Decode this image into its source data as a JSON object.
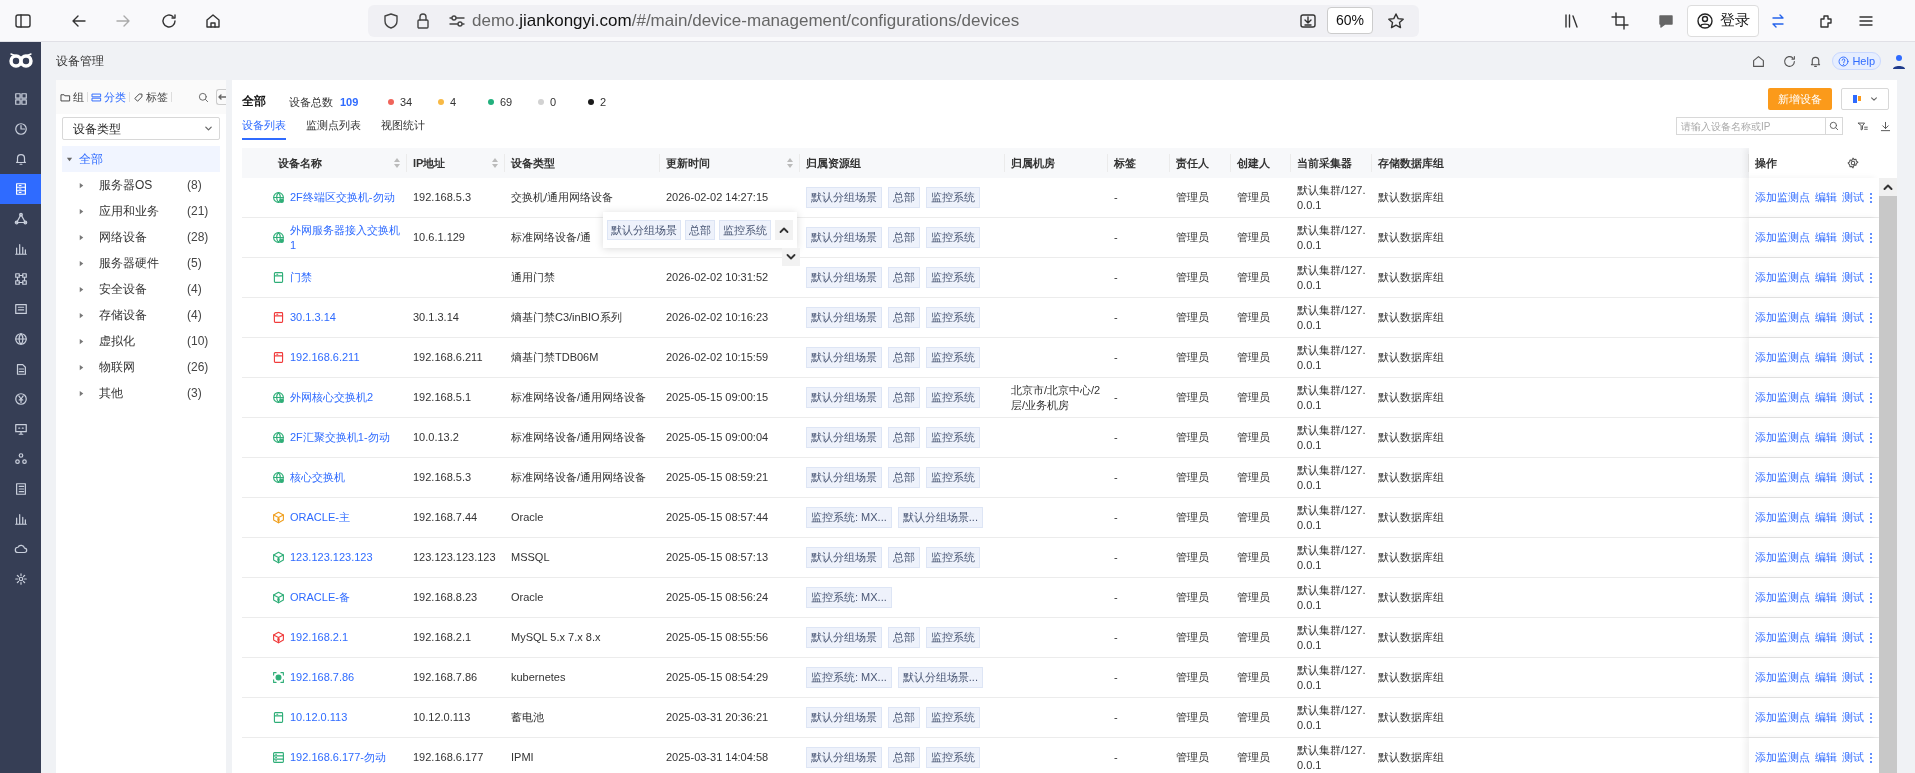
{
  "browser": {
    "url": {
      "prefix": "demo.",
      "domain": "jiankongyi.com",
      "path": "/#/main/device-management/configurations/devices"
    },
    "zoom": "60%",
    "account_label": "登录"
  },
  "app": {
    "page_title": "设备管理",
    "help_label": "Help"
  },
  "nav": [
    {
      "kind": "grid",
      "selected": false
    },
    {
      "kind": "clock",
      "selected": false
    },
    {
      "kind": "bell",
      "selected": false
    },
    {
      "kind": "server",
      "selected": true
    },
    {
      "kind": "triangle",
      "selected": false
    },
    {
      "kind": "bars",
      "selected": false
    },
    {
      "kind": "nodes",
      "selected": false
    },
    {
      "kind": "panel",
      "selected": false
    },
    {
      "kind": "globe",
      "selected": false
    },
    {
      "kind": "document",
      "selected": false
    },
    {
      "kind": "yen",
      "selected": false
    },
    {
      "kind": "monitor",
      "selected": false
    },
    {
      "kind": "cluster",
      "selected": false
    },
    {
      "kind": "list",
      "selected": false
    },
    {
      "kind": "bars",
      "selected": false
    },
    {
      "kind": "cloud",
      "selected": false
    },
    {
      "kind": "gear",
      "selected": false
    }
  ],
  "tree_panel": {
    "tabs": [
      {
        "label": "组",
        "kind": "folder",
        "selected": false
      },
      {
        "label": "分类",
        "kind": "category",
        "selected": true
      },
      {
        "label": "标签",
        "kind": "tag",
        "selected": false
      }
    ],
    "select": "设备类型",
    "tree": [
      {
        "label": "全部",
        "expanded": true,
        "selected": true,
        "children": [
          {
            "label": "服务器OS",
            "count": "(8)",
            "expanded": false,
            "selected": false
          },
          {
            "label": "应用和业务",
            "count": "(21)",
            "expanded": false,
            "selected": false
          },
          {
            "label": "网络设备",
            "count": "(28)",
            "expanded": false,
            "selected": false
          },
          {
            "label": "服务器硬件",
            "count": "(5)",
            "expanded": false,
            "selected": false
          },
          {
            "label": "安全设备",
            "count": "(4)",
            "expanded": false,
            "selected": false
          },
          {
            "label": "存储设备",
            "count": "(4)",
            "expanded": false,
            "selected": false
          },
          {
            "label": "虚拟化",
            "count": "(10)",
            "expanded": false,
            "selected": false
          },
          {
            "label": "物联网",
            "count": "(26)",
            "expanded": false,
            "selected": false
          },
          {
            "label": "其他",
            "count": "(3)",
            "expanded": false,
            "selected": false
          }
        ]
      }
    ]
  },
  "summary": {
    "title": "全部",
    "total_label": "设备总数",
    "total": "109",
    "statuses": [
      {
        "count": "34",
        "color": "#f0645a"
      },
      {
        "count": "4",
        "color": "#f8b945"
      },
      {
        "count": "69",
        "color": "#22b07d"
      },
      {
        "count": "0",
        "color": "#d2d2d2"
      },
      {
        "count": "2",
        "color": "#1a1a1a"
      }
    ]
  },
  "tabs": [
    {
      "label": "设备列表",
      "selected": true
    },
    {
      "label": "监测点列表",
      "selected": false
    },
    {
      "label": "视图统计",
      "selected": false
    }
  ],
  "actions": {
    "new_button": "新增设备",
    "search_placeholder": "请输入设备名称或IP"
  },
  "table": {
    "columns": [
      {
        "label": "设备名称",
        "sortable": true
      },
      {
        "label": "IP地址",
        "sortable": true
      },
      {
        "label": "设备类型",
        "sortable": false
      },
      {
        "label": "更新时间",
        "sortable": true
      },
      {
        "label": "归属资源组",
        "sortable": false
      },
      {
        "label": "归属机房",
        "sortable": false
      },
      {
        "label": "标签",
        "sortable": false
      },
      {
        "label": "责任人",
        "sortable": false
      },
      {
        "label": "创建人",
        "sortable": false
      },
      {
        "label": "当前采集器",
        "sortable": false
      },
      {
        "label": "存储数据库组",
        "sortable": false
      }
    ],
    "ops_column": "操作",
    "rows": [
      {
        "kind": "network",
        "color": "#2fae78",
        "name": "2F终端区交换机-勿动",
        "ip": "192.168.5.3",
        "type": "交换机/通用网络设备",
        "time": "2026-02-02 14:27:15",
        "groups": [
          "默认分组场景",
          "总部",
          "监控系统"
        ],
        "tag": "-",
        "owner": "管理员",
        "creator": "管理员",
        "collector": "默认集群/127.0.0.1",
        "db": "默认数据库组",
        "actions": [
          "添加监测点",
          "编辑",
          "测试"
        ]
      },
      {
        "kind": "network",
        "color": "#2fae78",
        "name": "外网服务器接入交换机1",
        "ip": "10.6.1.129",
        "type": "标准网络设备/通",
        "groups": [
          "默认分组场景",
          "总部",
          "监控系统"
        ],
        "tag": "-",
        "owner": "管理员",
        "creator": "管理员",
        "collector": "默认集群/127.0.0.1",
        "db": "默认数据库组",
        "actions": [
          "添加监测点",
          "编辑",
          "测试"
        ]
      },
      {
        "kind": "door",
        "color": "#2fae78",
        "name": "门禁",
        "type": "通用门禁",
        "time": "2026-02-02 10:31:52",
        "groups": [
          "默认分组场景",
          "总部",
          "监控系统"
        ],
        "tag": "-",
        "owner": "管理员",
        "creator": "管理员",
        "collector": "默认集群/127.0.0.1",
        "db": "默认数据库组",
        "actions": [
          "添加监测点",
          "编辑",
          "测试"
        ]
      },
      {
        "kind": "door",
        "color": "#f03c3c",
        "name": "30.1.3.14",
        "ip": "30.1.3.14",
        "type": "熵基门禁C3/inBIO系列",
        "time": "2026-02-02 10:16:23",
        "groups": [
          "默认分组场景",
          "总部",
          "监控系统"
        ],
        "tag": "-",
        "owner": "管理员",
        "creator": "管理员",
        "collector": "默认集群/127.0.0.1",
        "db": "默认数据库组",
        "actions": [
          "添加监测点",
          "编辑",
          "测试"
        ]
      },
      {
        "kind": "door",
        "color": "#f03c3c",
        "name": "192.168.6.211",
        "ip": "192.168.6.211",
        "type": "熵基门禁TDB06M",
        "time": "2026-02-02 10:15:59",
        "groups": [
          "默认分组场景",
          "总部",
          "监控系统"
        ],
        "tag": "-",
        "owner": "管理员",
        "creator": "管理员",
        "collector": "默认集群/127.0.0.1",
        "db": "默认数据库组",
        "actions": [
          "添加监测点",
          "编辑",
          "测试"
        ]
      },
      {
        "kind": "network",
        "color": "#2fae78",
        "name": "外网核心交换机2",
        "ip": "192.168.5.1",
        "type": "标准网络设备/通用网络设备",
        "time": "2025-05-15 09:00:15",
        "groups": [
          "默认分组场景",
          "总部",
          "监控系统"
        ],
        "room": "北京市/北京中心/2层/业务机房",
        "tag": "-",
        "owner": "管理员",
        "creator": "管理员",
        "collector": "默认集群/127.0.0.1",
        "db": "默认数据库组",
        "actions": [
          "添加监测点",
          "编辑",
          "测试"
        ]
      },
      {
        "kind": "network",
        "color": "#2fae78",
        "name": "2F汇聚交换机1-勿动",
        "ip": "10.0.13.2",
        "type": "标准网络设备/通用网络设备",
        "time": "2025-05-15 09:00:04",
        "groups": [
          "默认分组场景",
          "总部",
          "监控系统"
        ],
        "tag": "-",
        "owner": "管理员",
        "creator": "管理员",
        "collector": "默认集群/127.0.0.1",
        "db": "默认数据库组",
        "actions": [
          "添加监测点",
          "编辑",
          "测试"
        ]
      },
      {
        "kind": "network",
        "color": "#2fae78",
        "name": "核心交换机",
        "ip": "192.168.5.3",
        "type": "标准网络设备/通用网络设备",
        "time": "2025-05-15 08:59:21",
        "groups": [
          "默认分组场景",
          "总部",
          "监控系统"
        ],
        "tag": "-",
        "owner": "管理员",
        "creator": "管理员",
        "collector": "默认集群/127.0.0.1",
        "db": "默认数据库组",
        "actions": [
          "添加监测点",
          "编辑",
          "测试"
        ]
      },
      {
        "kind": "database",
        "color": "#f0a020",
        "name": "ORACLE-主",
        "ip": "192.168.7.44",
        "type": "Oracle",
        "time": "2025-05-15 08:57:44",
        "groups": [
          "监控系统: MX...",
          "默认分组场景..."
        ],
        "tag": "-",
        "owner": "管理员",
        "creator": "管理员",
        "collector": "默认集群/127.0.0.1",
        "db": "默认数据库组",
        "actions": [
          "添加监测点",
          "编辑",
          "测试"
        ]
      },
      {
        "kind": "database",
        "color": "#2fae78",
        "name": "123.123.123.123",
        "ip": "123.123.123.123",
        "type": "MSSQL",
        "time": "2025-05-15 08:57:13",
        "groups": [
          "默认分组场景",
          "总部",
          "监控系统"
        ],
        "tag": "-",
        "owner": "管理员",
        "creator": "管理员",
        "collector": "默认集群/127.0.0.1",
        "db": "默认数据库组",
        "actions": [
          "添加监测点",
          "编辑",
          "测试"
        ]
      },
      {
        "kind": "database",
        "color": "#2fae78",
        "name": "ORACLE-备",
        "ip": "192.168.8.23",
        "type": "Oracle",
        "time": "2025-05-15 08:56:24",
        "groups": [
          "监控系统: MX..."
        ],
        "tag": "-",
        "owner": "管理员",
        "creator": "管理员",
        "collector": "默认集群/127.0.0.1",
        "db": "默认数据库组",
        "actions": [
          "添加监测点",
          "编辑",
          "测试"
        ]
      },
      {
        "kind": "database",
        "color": "#f03c3c",
        "name": "192.168.2.1",
        "ip": "192.168.2.1",
        "type": "MySQL 5.x 7.x 8.x",
        "time": "2025-05-15 08:55:56",
        "groups": [
          "默认分组场景",
          "总部",
          "监控系统"
        ],
        "tag": "-",
        "owner": "管理员",
        "creator": "管理员",
        "collector": "默认集群/127.0.0.1",
        "db": "默认数据库组",
        "actions": [
          "添加监测点",
          "编辑",
          "测试"
        ]
      },
      {
        "kind": "container",
        "color": "#2fae78",
        "name": "192.168.7.86",
        "ip": "192.168.7.86",
        "type": "kubernetes",
        "time": "2025-05-15 08:54:29",
        "groups": [
          "监控系统: MX...",
          "默认分组场景..."
        ],
        "tag": "-",
        "owner": "管理员",
        "creator": "管理员",
        "collector": "默认集群/127.0.0.1",
        "db": "默认数据库组",
        "actions": [
          "添加监测点",
          "编辑",
          "测试"
        ]
      },
      {
        "kind": "door",
        "color": "#2fae78",
        "name": "10.12.0.113",
        "ip": "10.12.0.113",
        "type": "蓄电池",
        "time": "2025-03-31 20:36:21",
        "groups": [
          "默认分组场景",
          "总部",
          "监控系统"
        ],
        "tag": "-",
        "owner": "管理员",
        "creator": "管理员",
        "collector": "默认集群/127.0.0.1",
        "db": "默认数据库组",
        "actions": [
          "添加监测点",
          "编辑",
          "测试"
        ]
      },
      {
        "kind": "rack",
        "color": "#2fae78",
        "name": "192.168.6.177-勿动",
        "ip": "192.168.6.177",
        "type": "IPMI",
        "time": "2025-03-31 14:04:58",
        "groups": [
          "默认分组场景",
          "总部",
          "监控系统"
        ],
        "tag": "-",
        "owner": "管理员",
        "creator": "管理员",
        "collector": "默认集群/127.0.0.1",
        "db": "默认数据库组",
        "actions": [
          "添加监测点",
          "编辑",
          "测试"
        ]
      }
    ]
  },
  "popover": {
    "tags": [
      "默认分组场景",
      "总部",
      "监控系统"
    ]
  }
}
